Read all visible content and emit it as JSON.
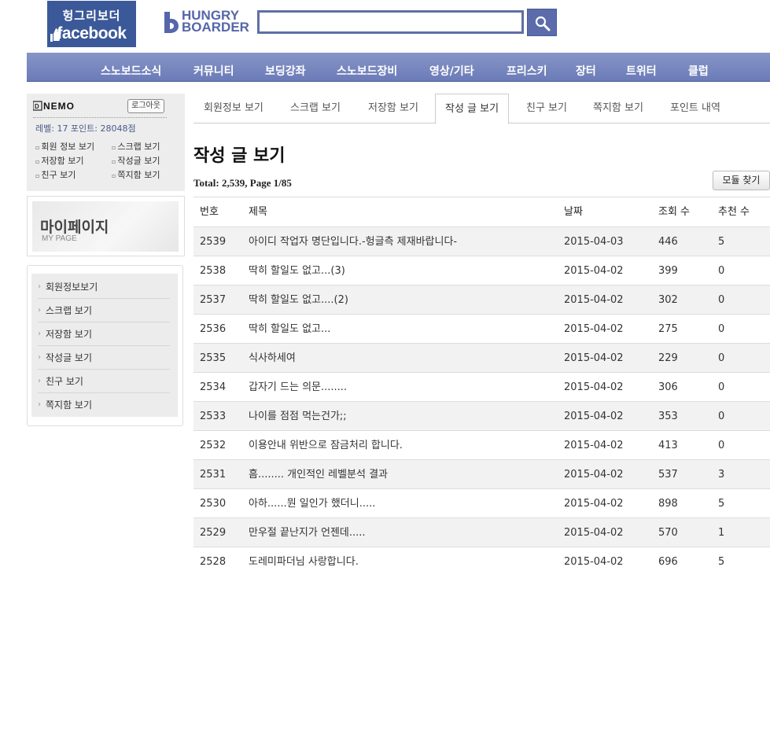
{
  "header": {
    "fb_logo_line1": "헝그리보더",
    "fb_logo_line2": "facebook",
    "hb_logo_line1": "HUNGRY",
    "hb_logo_line2": "BOARDER",
    "search_value": ""
  },
  "nav": [
    "스노보드소식",
    "커뮤니티",
    "보딩강좌",
    "스노보드장비",
    "영상/기타",
    "프리스키",
    "장터",
    "트위터",
    "클럽"
  ],
  "login": {
    "brand": "NEMO",
    "logout_label": "로그아웃",
    "level_text": "레벨: 17   포인트: 28048점",
    "links": [
      "회원 정보 보기",
      "스크랩 보기",
      "저장함 보기",
      "작성글 보기",
      "친구 보기",
      "쪽지함 보기"
    ]
  },
  "mypage": {
    "title": "마이페이지",
    "subtitle": "MY PAGE"
  },
  "side_menu": [
    "회원정보보기",
    "스크랩 보기",
    "저장함 보기",
    "작성글 보기",
    "친구 보기",
    "쪽지함 보기"
  ],
  "tabs": [
    {
      "label": "회원정보 보기",
      "active": false
    },
    {
      "label": "스크랩 보기",
      "active": false
    },
    {
      "label": "저장함 보기",
      "active": false
    },
    {
      "label": "작성 글 보기",
      "active": true
    },
    {
      "label": "친구 보기",
      "active": false
    },
    {
      "label": "쪽지함 보기",
      "active": false
    },
    {
      "label": "포인트 내역",
      "active": false
    }
  ],
  "main": {
    "title": "작성 글 보기",
    "total": "Total: 2,539, Page 1/85",
    "module_button": "모듈 찾기",
    "columns": [
      "번호",
      "제목",
      "날짜",
      "조회 수",
      "추천 수"
    ],
    "rows": [
      [
        "2539",
        "아이디 작업자 명단입니다.-헝글측 제재바랍니다-",
        "2015-04-03",
        "446",
        "5"
      ],
      [
        "2538",
        "딱히 할일도 없고...(3)",
        "2015-04-02",
        "399",
        "0"
      ],
      [
        "2537",
        "딱히 할일도 없고....(2)",
        "2015-04-02",
        "302",
        "0"
      ],
      [
        "2536",
        "딱히 할일도 없고...",
        "2015-04-02",
        "275",
        "0"
      ],
      [
        "2535",
        "식사하세여",
        "2015-04-02",
        "229",
        "0"
      ],
      [
        "2534",
        "갑자기 드는 의문........",
        "2015-04-02",
        "306",
        "0"
      ],
      [
        "2533",
        "나이를 점점 먹는건가;;",
        "2015-04-02",
        "353",
        "0"
      ],
      [
        "2532",
        "이용안내 위반으로 잠금처리 합니다.",
        "2015-04-02",
        "413",
        "0"
      ],
      [
        "2531",
        "흠........ 개인적인 레벨분석 결과",
        "2015-04-02",
        "537",
        "3"
      ],
      [
        "2530",
        "아하......뭔 일인가 했더니.....",
        "2015-04-02",
        "898",
        "5"
      ],
      [
        "2529",
        "만우절 끝난지가 언젠데.....",
        "2015-04-02",
        "570",
        "1"
      ],
      [
        "2528",
        "도레미파더님 사랑합니다.",
        "2015-04-02",
        "696",
        "5"
      ]
    ]
  }
}
